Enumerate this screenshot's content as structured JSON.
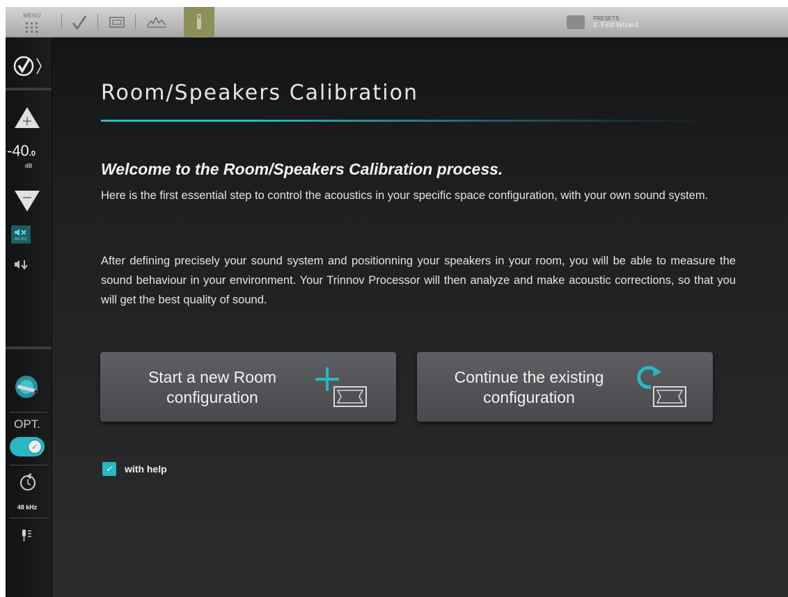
{
  "topbar": {
    "menu_label": "MENU",
    "presets_label": "PRESETS",
    "presets_value": "2. First Wizard"
  },
  "sidebar": {
    "volume_value": "-40",
    "volume_decimal": ".0",
    "volume_unit": "dB",
    "mute_label": "MUTED",
    "input_label": "OPT.",
    "sample_rate": "48 kHz"
  },
  "main": {
    "title": "Room/Speakers Calibration",
    "welcome_heading": "Welcome to the Room/Speakers Calibration process.",
    "paragraph1": "Here is the first essential step to control the acoustics in your specific space configuration, with your own sound system.",
    "paragraph2": "After defining precisely your sound system and positionning your speakers in your room, you will be able to measure the sound behaviour in your environment. Your Trinnov Processor will then analyze and make acoustic corrections, so that you will get the best quality of sound.",
    "start_button": {
      "line1": "Start a new Room",
      "line2": "configuration"
    },
    "continue_button": {
      "line1": "Continue the existing",
      "line2": "configuration"
    },
    "with_help_label": "with help",
    "with_help_checked": true
  },
  "colors": {
    "accent": "#2bb6c3",
    "background": "#1c1d1f",
    "button": "#54555a",
    "mic_tab": "#8c8f5a"
  }
}
